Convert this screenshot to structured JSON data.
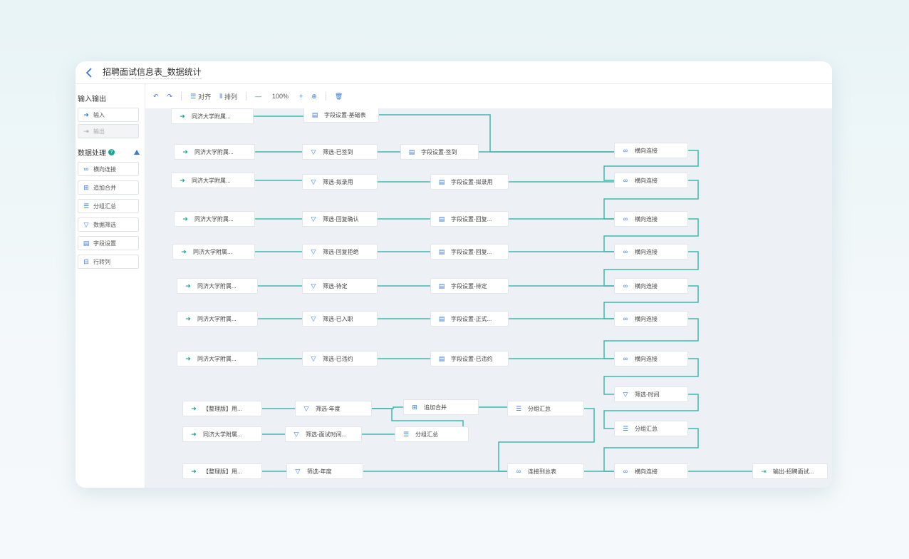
{
  "window": {
    "title": "招聘面试信息表_数据统计"
  },
  "sidebar": {
    "section_io": "输入输出",
    "io_items": [
      {
        "label": "输入",
        "icon": "input-icon",
        "glyph": "➜"
      },
      {
        "label": "输出",
        "icon": "output-icon",
        "glyph": "⇥"
      }
    ],
    "section_process": "数据处理",
    "process_items": [
      {
        "label": "横向连接",
        "icon": "join-icon",
        "glyph": "∞"
      },
      {
        "label": "追加合并",
        "icon": "append-icon",
        "glyph": "⊞"
      },
      {
        "label": "分组汇总",
        "icon": "group-icon",
        "glyph": "☰"
      },
      {
        "label": "数据筛选",
        "icon": "filter-icon",
        "glyph": "▽"
      },
      {
        "label": "字段设置",
        "icon": "field-icon",
        "glyph": "▤"
      },
      {
        "label": "行转列",
        "icon": "pivot-icon",
        "glyph": "⊟"
      }
    ]
  },
  "toolbar": {
    "align_label": "对齐",
    "arrange_label": "排列",
    "zoom": "100%"
  },
  "colors": {
    "accent": "#3a7bd5",
    "wire": "#3fb7ac",
    "canvas": "#edf0f5"
  },
  "nodes": [
    {
      "label": "同济大学附属...",
      "icon": "input-icon"
    },
    {
      "label": "字段设置-基础表",
      "icon": "field-icon"
    },
    {
      "label": "同济大学附属...",
      "icon": "input-icon"
    },
    {
      "label": "筛选-已签到",
      "icon": "filter-icon"
    },
    {
      "label": "字段设置-签到",
      "icon": "field-icon"
    },
    {
      "label": "横向连接",
      "icon": "join-icon"
    },
    {
      "label": "同济大学附属...",
      "icon": "input-icon"
    },
    {
      "label": "筛选-拟录用",
      "icon": "filter-icon"
    },
    {
      "label": "字段设置-拟录用",
      "icon": "field-icon"
    },
    {
      "label": "横向连接",
      "icon": "join-icon"
    },
    {
      "label": "同济大学附属...",
      "icon": "input-icon"
    },
    {
      "label": "筛选-回复确认",
      "icon": "filter-icon"
    },
    {
      "label": "字段设置-回复...",
      "icon": "field-icon"
    },
    {
      "label": "横向连接",
      "icon": "join-icon"
    },
    {
      "label": "同济大学附属...",
      "icon": "input-icon"
    },
    {
      "label": "筛选-回复拒绝",
      "icon": "filter-icon"
    },
    {
      "label": "字段设置-回复...",
      "icon": "field-icon"
    },
    {
      "label": "横向连接",
      "icon": "join-icon"
    },
    {
      "label": "同济大学附属...",
      "icon": "input-icon"
    },
    {
      "label": "筛选-待定",
      "icon": "filter-icon"
    },
    {
      "label": "字段设置-待定",
      "icon": "field-icon"
    },
    {
      "label": "横向连接",
      "icon": "join-icon"
    },
    {
      "label": "同济大学附属...",
      "icon": "input-icon"
    },
    {
      "label": "筛选-已入职",
      "icon": "filter-icon"
    },
    {
      "label": "字段设置-正式...",
      "icon": "field-icon"
    },
    {
      "label": "横向连接",
      "icon": "join-icon"
    },
    {
      "label": "同济大学附属...",
      "icon": "input-icon"
    },
    {
      "label": "筛选-已违约",
      "icon": "filter-icon"
    },
    {
      "label": "字段设置-已违约",
      "icon": "field-icon"
    },
    {
      "label": "横向连接",
      "icon": "join-icon"
    },
    {
      "label": "筛选-时间",
      "icon": "filter-icon"
    },
    {
      "label": "【整理版】用...",
      "icon": "input-icon"
    },
    {
      "label": "筛选-年度",
      "icon": "filter-icon"
    },
    {
      "label": "追加合并",
      "icon": "append-icon"
    },
    {
      "label": "分组汇总",
      "icon": "group-icon"
    },
    {
      "label": "分组汇总",
      "icon": "group-icon"
    },
    {
      "label": "同济大学附属...",
      "icon": "input-icon"
    },
    {
      "label": "筛选-面试时间...",
      "icon": "filter-icon"
    },
    {
      "label": "分组汇总",
      "icon": "group-icon"
    },
    {
      "label": "【整理版】用...",
      "icon": "input-icon"
    },
    {
      "label": "筛选-年度",
      "icon": "filter-icon"
    },
    {
      "label": "连接到总表",
      "icon": "join-icon"
    },
    {
      "label": "横向连接",
      "icon": "join-icon"
    },
    {
      "label": "输出-招聘面试...",
      "icon": "output-icon"
    }
  ]
}
